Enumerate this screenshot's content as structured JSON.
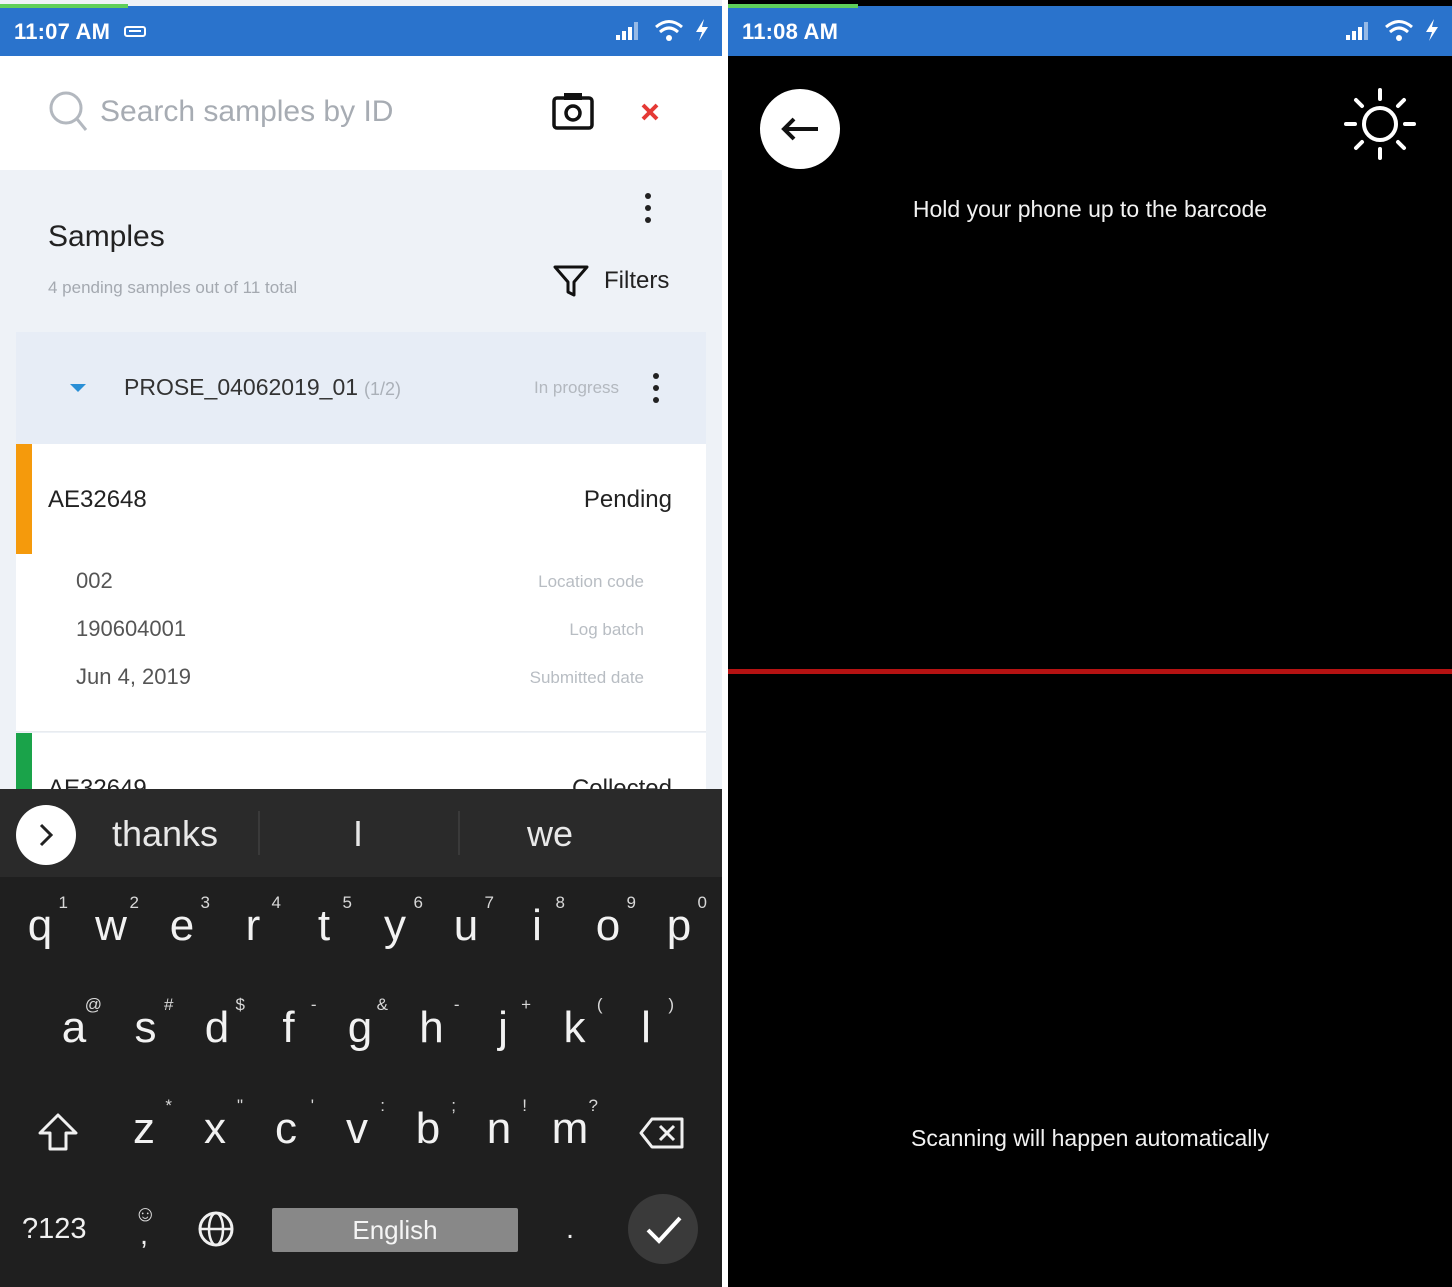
{
  "left_screen": {
    "status_bar": {
      "time": "11:07 AM"
    },
    "search": {
      "placeholder": "Search samples by ID",
      "value": ""
    },
    "header": {
      "title": "Samples",
      "subtitle": "4 pending samples out of 11 total",
      "filters_label": "Filters"
    },
    "group": {
      "name": "PROSE_04062019_01",
      "count": "(1/2)",
      "status": "In progress"
    },
    "samples": [
      {
        "id": "AE32648",
        "status": "Pending",
        "accent_color": "#f59a0c",
        "fields": [
          {
            "value": "002",
            "label": "Location code"
          },
          {
            "value": "190604001",
            "label": "Log batch"
          },
          {
            "value": "Jun 4, 2019",
            "label": "Submitted date"
          }
        ]
      },
      {
        "id": "AE32649",
        "status": "Collected",
        "accent_color": "#1aa34a"
      }
    ],
    "keyboard": {
      "suggestions": [
        "thanks",
        "I",
        "we"
      ],
      "row1": [
        {
          "key": "q",
          "hint": "1"
        },
        {
          "key": "w",
          "hint": "2"
        },
        {
          "key": "e",
          "hint": "3"
        },
        {
          "key": "r",
          "hint": "4"
        },
        {
          "key": "t",
          "hint": "5"
        },
        {
          "key": "y",
          "hint": "6"
        },
        {
          "key": "u",
          "hint": "7"
        },
        {
          "key": "i",
          "hint": "8"
        },
        {
          "key": "o",
          "hint": "9"
        },
        {
          "key": "p",
          "hint": "0"
        }
      ],
      "row2": [
        {
          "key": "a",
          "hint": "@"
        },
        {
          "key": "s",
          "hint": "#"
        },
        {
          "key": "d",
          "hint": "$"
        },
        {
          "key": "f",
          "hint": "-"
        },
        {
          "key": "g",
          "hint": "&"
        },
        {
          "key": "h",
          "hint": "-"
        },
        {
          "key": "j",
          "hint": "+"
        },
        {
          "key": "k",
          "hint": "("
        },
        {
          "key": "l",
          "hint": ")"
        }
      ],
      "row3": [
        {
          "key": "z",
          "hint": "*"
        },
        {
          "key": "x",
          "hint": "\""
        },
        {
          "key": "c",
          "hint": "'"
        },
        {
          "key": "v",
          "hint": ":"
        },
        {
          "key": "b",
          "hint": ";"
        },
        {
          "key": "n",
          "hint": "!"
        },
        {
          "key": "m",
          "hint": "?"
        }
      ],
      "symbols_label": "?123",
      "emoji_label": "☺",
      "comma_label": ",",
      "space_label": "English",
      "period_label": "."
    }
  },
  "right_screen": {
    "status_bar": {
      "time": "11:08 AM"
    },
    "instruction_top": "Hold your phone up to the barcode",
    "instruction_bottom": "Scanning will happen automatically",
    "scan_line_color": "#b51212"
  },
  "colors": {
    "status_bar": "#2a73cc",
    "close_icon": "#e53935",
    "caret": "#2a8fd6"
  }
}
